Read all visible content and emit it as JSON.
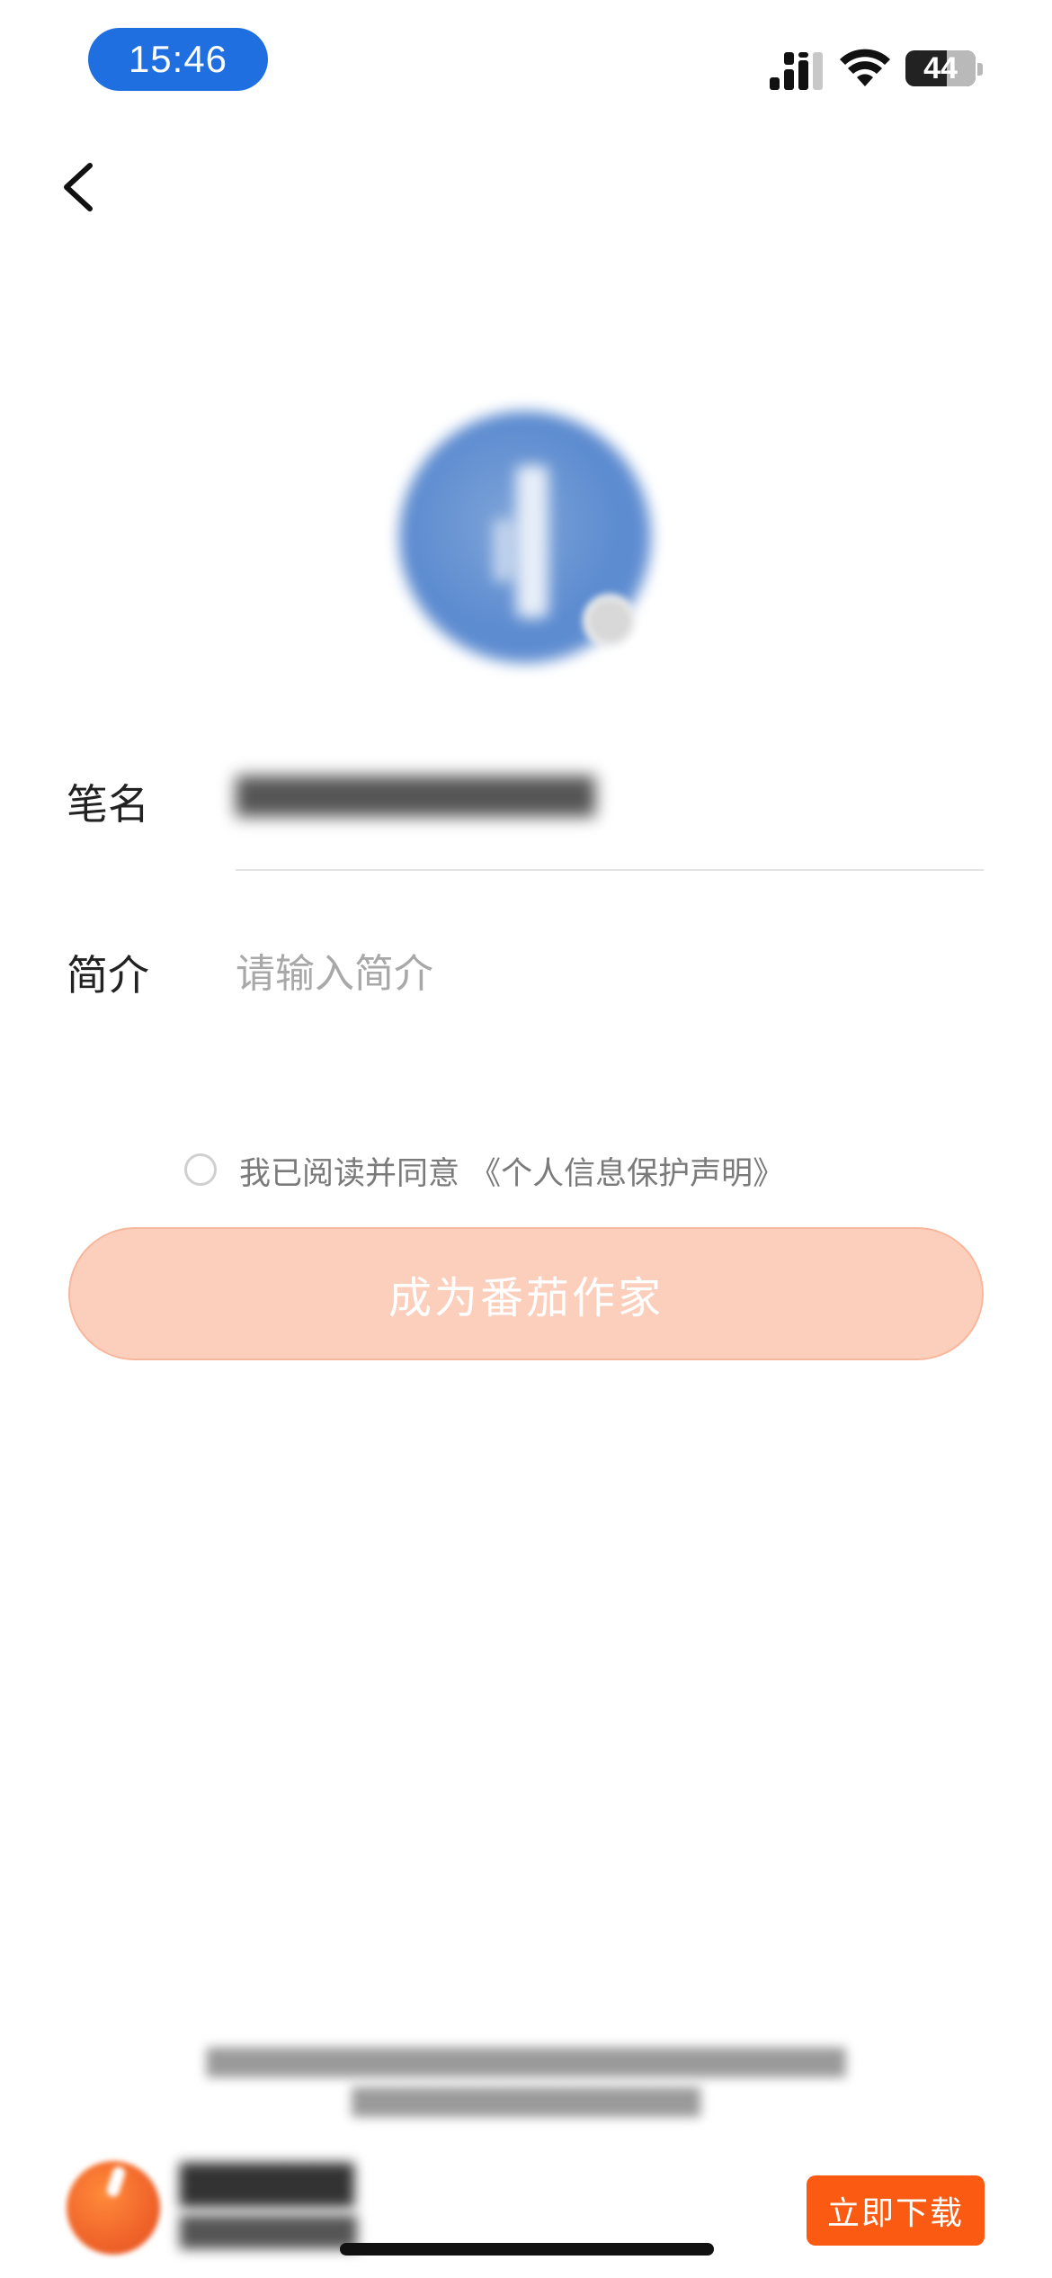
{
  "status_bar": {
    "time": "15:46",
    "battery_level": "44",
    "icons": [
      "cellular-signal-icon",
      "wifi-icon",
      "battery-icon"
    ]
  },
  "nav": {
    "back_icon": "chevron-left-icon"
  },
  "profile": {
    "avatar_icon": "avatar-image",
    "pen_name_label": "笔名",
    "pen_name_value": "█████████████",
    "intro_label": "简介",
    "intro_placeholder": "请输入简介",
    "intro_value": ""
  },
  "agreement": {
    "checked": false,
    "text": "我已阅读并同意",
    "link_text": "《个人信息保护声明》"
  },
  "primary_button": {
    "label": "成为番茄作家",
    "state": "disabled"
  },
  "footer": {
    "line1": "█████████████████████████████████",
    "line2": "██████████████████"
  },
  "banner": {
    "app_name": "██████",
    "app_subtitle": "████████",
    "download_label": "立即下载"
  },
  "colors": {
    "accent": "#fb5a12",
    "button_disabled_bg": "#fccfbd",
    "time_pill": "#1f6fe0"
  }
}
